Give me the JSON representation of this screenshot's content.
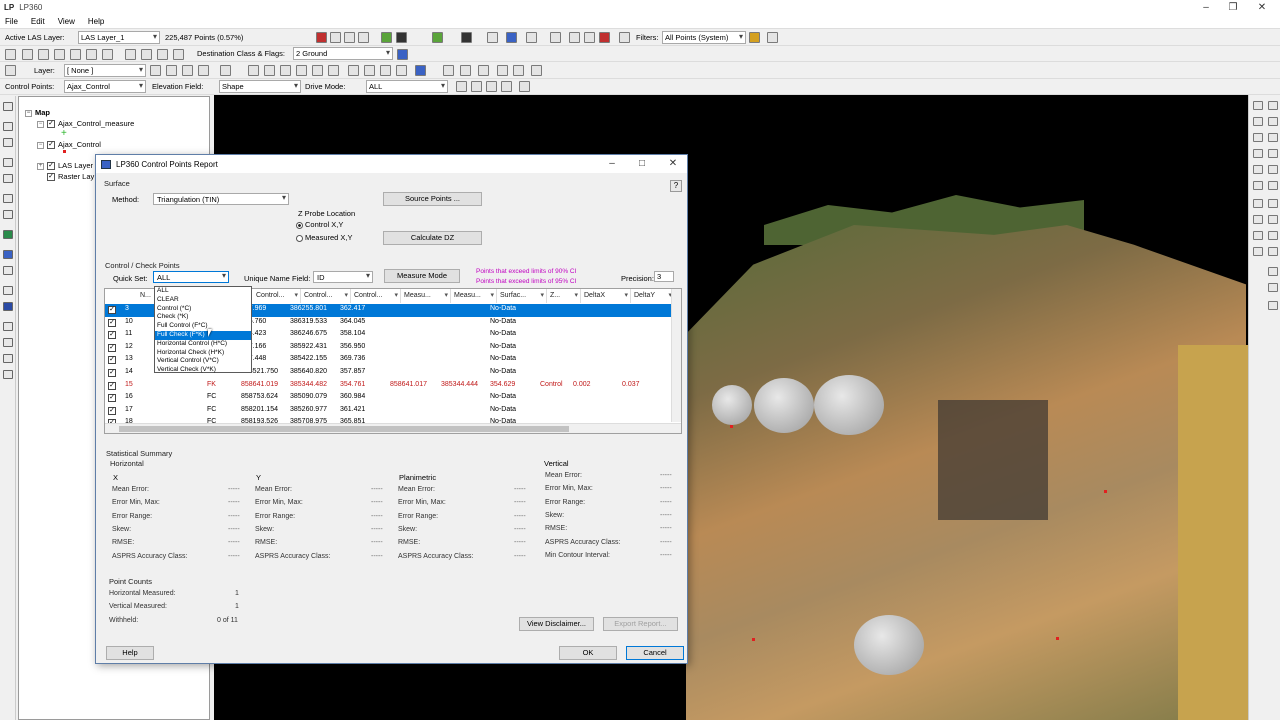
{
  "app": {
    "logo": "LP",
    "title": "LP360"
  },
  "menu": [
    "File",
    "Edit",
    "View",
    "Help"
  ],
  "toolbar1": {
    "active_layer_label": "Active LAS Layer:",
    "active_layer_value": "LAS Layer_1",
    "points_readout": "225,487 Points (0.57%)",
    "dest_class_label": "Destination Class & Flags:",
    "dest_class_value": "2  Ground",
    "filters_label": "Filters:",
    "filters_value": "All Points (System)"
  },
  "toolbar2": {
    "layer_label": "Layer:",
    "layer_value": "[ None ]"
  },
  "toolbar3": {
    "control_points_label": "Control Points:",
    "control_points_value": "Ajax_Control",
    "elevation_label": "Elevation Field:",
    "elevation_value": "Shape",
    "drive_mode_label": "Drive Mode:",
    "drive_mode_value": "ALL"
  },
  "layers": {
    "root": "Map",
    "items": [
      "Ajax_Control_measure",
      "Ajax_Control",
      "LAS Layer",
      "Raster Lay"
    ]
  },
  "dialog": {
    "title": "LP360 Control Points Report",
    "surface_group": "Surface",
    "method_label": "Method:",
    "method_value": "Triangulation (TIN)",
    "source_points_btn": "Source Points ...",
    "z_probe_label": "Z Probe Location",
    "radio_control": "Control X,Y",
    "radio_measured": "Measured X,Y",
    "calculate_dz_btn": "Calculate DZ",
    "cp_group": "Control / Check Points",
    "quick_set_label": "Quick Set:",
    "quick_set_value": "ALL",
    "unique_name_label": "Unique Name Field:",
    "unique_name_value": "ID",
    "measure_mode_btn": "Measure Mode",
    "warn90": "Points that exceed limits of 90% CI",
    "warn95": "Points that exceed limits of 95% CI",
    "precision_label": "Precision:",
    "precision_value": "3",
    "quickset_options": [
      "ALL",
      "CLEAR",
      "Control (*C)",
      "Check (*K)",
      "Full Control (F*C)",
      "Full Check (F*K)",
      "Horizontal Control (H*C)",
      "Horizontal Check (H*K)",
      "Vertical Control (V*C)",
      "Vertical Check (V*K)"
    ],
    "columns": [
      "N...",
      "Control...",
      "Control...",
      "Control...",
      "Measu...",
      "Measu...",
      "Surfac...",
      "Z...",
      "DeltaX",
      "DeltaY"
    ],
    "rows": [
      {
        "id": "3",
        "type": "",
        "cx": "337.969",
        "cy": "386255.801",
        "cz": "362.417",
        "mx": "",
        "my": "",
        "surf": "No-Data",
        "z": "",
        "dx": "",
        "dy": ""
      },
      {
        "id": "10",
        "type": "",
        "cx": "165.760",
        "cy": "386319.533",
        "cz": "364.045",
        "mx": "",
        "my": "",
        "surf": "No-Data",
        "z": "",
        "dx": "",
        "dy": ""
      },
      {
        "id": "11",
        "type": "",
        "cx": "364.423",
        "cy": "386246.675",
        "cz": "358.104",
        "mx": "",
        "my": "",
        "surf": "No-Data",
        "z": "",
        "dx": "",
        "dy": ""
      },
      {
        "id": "12",
        "type": "",
        "cx": "347.166",
        "cy": "385922.431",
        "cz": "356.950",
        "mx": "",
        "my": "",
        "surf": "No-Data",
        "z": "",
        "dx": "",
        "dy": ""
      },
      {
        "id": "13",
        "type": "",
        "cx": "357.448",
        "cy": "385422.155",
        "cz": "369.736",
        "mx": "",
        "my": "",
        "surf": "No-Data",
        "z": "",
        "dx": "",
        "dy": ""
      },
      {
        "id": "14",
        "type": "FC",
        "cx": "858521.750",
        "cy": "385640.820",
        "cz": "357.857",
        "mx": "",
        "my": "",
        "surf": "No-Data",
        "z": "",
        "dx": "",
        "dy": ""
      },
      {
        "id": "15",
        "type": "FK",
        "cx": "858641.019",
        "cy": "385344.482",
        "cz": "354.761",
        "mx": "858641.017",
        "my": "385344.444",
        "surf": "354.629",
        "z": "Control",
        "dx": "0.002",
        "dy": "0.037"
      },
      {
        "id": "16",
        "type": "FC",
        "cx": "858753.624",
        "cy": "385090.079",
        "cz": "360.984",
        "mx": "",
        "my": "",
        "surf": "No-Data",
        "z": "",
        "dx": "",
        "dy": ""
      },
      {
        "id": "17",
        "type": "FC",
        "cx": "858201.154",
        "cy": "385260.977",
        "cz": "361.421",
        "mx": "",
        "my": "",
        "surf": "No-Data",
        "z": "",
        "dx": "",
        "dy": ""
      },
      {
        "id": "18",
        "type": "FC",
        "cx": "858193.526",
        "cy": "385708.975",
        "cz": "365.851",
        "mx": "",
        "my": "",
        "surf": "No-Data",
        "z": "",
        "dx": "",
        "dy": ""
      }
    ],
    "stats": {
      "group": "Statistical Summary",
      "horizontal": "Horizontal",
      "x_label": "X",
      "y_label": "Y",
      "planimetric_label": "Planimetric",
      "vertical_label": "Vertical",
      "x_rows": [
        "Mean Error:",
        "Error Min, Max:",
        "Error Range:",
        "Skew:",
        "RMSE:",
        "ASPRS Accuracy Class:"
      ],
      "vertical_rows": [
        "Mean Error:",
        "Error Min, Max:",
        "Error Range:",
        "Skew:",
        "RMSE:",
        "ASPRS Accuracy Class:",
        "Min Contour Interval:"
      ],
      "dash": "-----"
    },
    "counts": {
      "group": "Point Counts",
      "h_label": "Horizontal Measured:",
      "h_value": "1",
      "v_label": "Vertical Measured:",
      "v_value": "1",
      "w_label": "Withheld:",
      "w_value": "0 of 11"
    },
    "view_disclaimer_btn": "View Disclaimer...",
    "export_report_btn": "Export Report...",
    "help_btn": "Help",
    "ok_btn": "OK",
    "cancel_btn": "Cancel"
  }
}
